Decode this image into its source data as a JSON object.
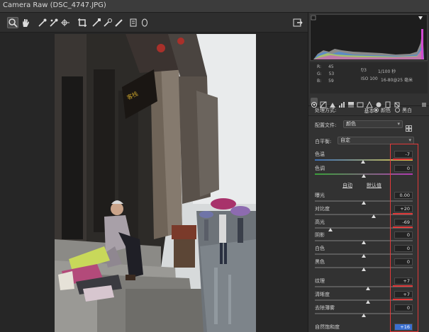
{
  "window": {
    "title": "Camera Raw (DSC_4747.JPG)"
  },
  "toolbar": {
    "tools": [
      "zoom-tool",
      "hand-tool",
      "white-balance-tool",
      "color-sampler-tool",
      "targeted-adjustment-tool",
      "crop-tool",
      "straighten-tool",
      "spot-removal-tool",
      "red-eye-tool",
      "adjustment-brush-tool",
      "graduated-filter-tool",
      "radial-filter-tool"
    ]
  },
  "info": {
    "r_label": "R:",
    "r_value": "45",
    "g_label": "G:",
    "g_value": "53",
    "b_label": "B:",
    "b_value": "59",
    "aperture": "f/3",
    "shutter": "1/100 秒",
    "iso": "ISO 100",
    "lens": "16-80@25 毫米"
  },
  "panel": {
    "section_title": "基本",
    "process_label": "处理方式:",
    "process_color": "颜色",
    "process_bw": "黑白",
    "profile_label": "配置文件:",
    "profile_value": "颜色",
    "wb_label": "白平衡:",
    "wb_value": "自定",
    "auto_label": "自动",
    "default_label": "默认值"
  },
  "sliders": [
    {
      "label": "色温",
      "value": "-7",
      "pos": 0.49,
      "red": true
    },
    {
      "label": "色调",
      "value": "0",
      "pos": 0.5,
      "red": false
    },
    {
      "label": "曝光",
      "value": "0.00",
      "pos": 0.5,
      "red": false
    },
    {
      "label": "对比度",
      "value": "+20",
      "pos": 0.6,
      "red": true
    },
    {
      "label": "高光",
      "value": "-69",
      "pos": 0.16,
      "red": true
    },
    {
      "label": "阴影",
      "value": "0",
      "pos": 0.5,
      "red": false
    },
    {
      "label": "白色",
      "value": "0",
      "pos": 0.5,
      "red": false
    },
    {
      "label": "黑色",
      "value": "0",
      "pos": 0.5,
      "red": false
    },
    {
      "label": "纹理",
      "value": "+7",
      "pos": 0.54,
      "red": true
    },
    {
      "label": "清晰度",
      "value": "+7",
      "pos": 0.54,
      "red": true
    },
    {
      "label": "去除薄雾",
      "value": "0",
      "pos": 0.5,
      "red": false
    },
    {
      "label": "自然饱和度",
      "value": "+16",
      "pos": 0.58,
      "red": false
    }
  ],
  "colors": {
    "highlight": "#e23a3a",
    "accent": "#3a6fd0"
  }
}
